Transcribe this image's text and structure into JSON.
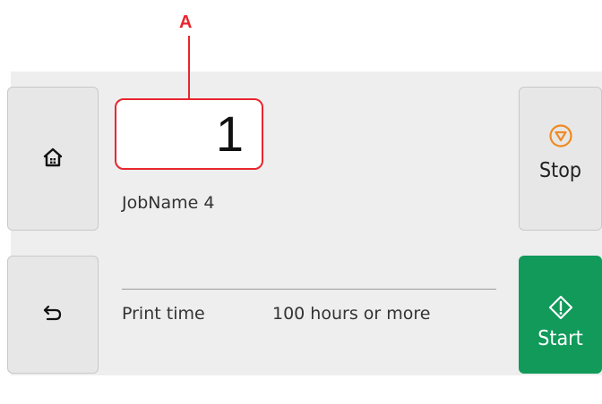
{
  "callout": {
    "label": "A"
  },
  "copies": {
    "value": "1"
  },
  "job": {
    "name": "JobName 4"
  },
  "print_time": {
    "label": "Print time",
    "value": "100 hours or more"
  },
  "buttons": {
    "home_icon": "home-icon",
    "back_icon": "back-arrow-icon",
    "stop_label": "Stop",
    "stop_icon": "stop-icon",
    "start_label": "Start",
    "start_icon": "start-diamond-icon"
  },
  "colors": {
    "callout": "#e8262e",
    "start_bg": "#119a5a",
    "stop_icon": "#f08a24",
    "panel_bg": "#eeeeee"
  }
}
